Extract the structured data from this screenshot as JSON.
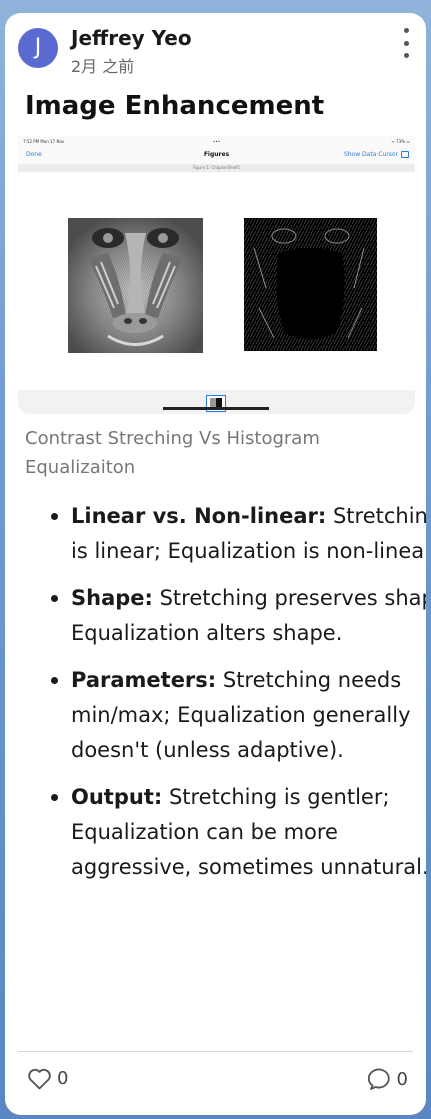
{
  "post": {
    "avatar_letter": "J",
    "author": "Jeffrey Yeo",
    "time": "2月 之前",
    "title": "Image Enhancement",
    "caption": "Contrast Streching Vs Histogram Equalizaiton"
  },
  "screenshot": {
    "status_left": "7:52 PM   Mon 17 Nov",
    "status_center": "•••",
    "status_right": "≈ 73% ▭",
    "nav_done": "Done",
    "nav_title": "Figures",
    "nav_cursor": "Show Data Cursor",
    "figure_label": "Figure 1: ChapterShelf1"
  },
  "points": [
    {
      "label": "Linear vs. Non-linear:",
      "text": " Stretching is linear; Equalization is non-linear."
    },
    {
      "label": "Shape:",
      "text": " Stretching preserves shape; Equalization alters shape."
    },
    {
      "label": "Parameters:",
      "text": " Stretching needs min/max; Equalization generally doesn't (unless adaptive)."
    },
    {
      "label": "Output:",
      "text": " Stretching is gentler; Equalization can be more aggressive, sometimes unnatural."
    }
  ],
  "footer": {
    "likes": "0",
    "comments": "0"
  },
  "colors": {
    "avatar": "#5b6ad0",
    "ios_blue": "#2a7ae2"
  }
}
